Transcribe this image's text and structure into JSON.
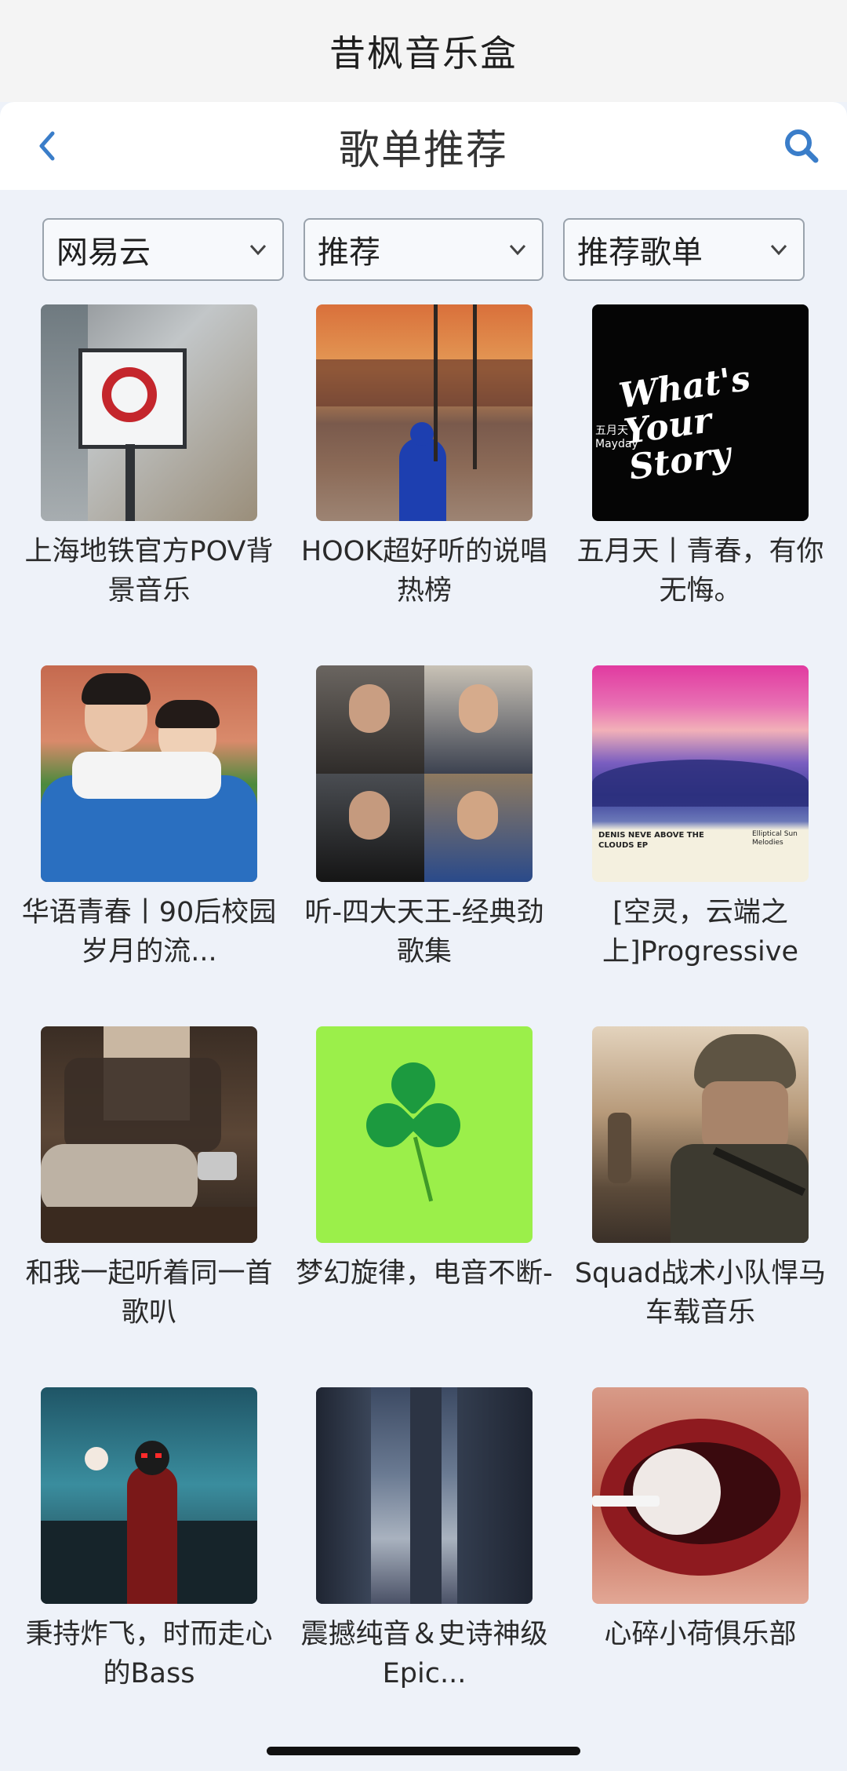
{
  "app": {
    "title": "昔枫音乐盒"
  },
  "header": {
    "title": "歌单推荐",
    "back_icon": "chevron-left-icon",
    "search_icon": "search-icon",
    "accent": "#3a7dc9"
  },
  "filters": [
    {
      "value": "网易云"
    },
    {
      "value": "推荐"
    },
    {
      "value": "推荐歌单"
    }
  ],
  "playlists": [
    {
      "name": "上海地铁官方POV背景音乐"
    },
    {
      "name": "HOOK超好听的说唱热榜"
    },
    {
      "name": "五月天丨青春，有你无悔。",
      "cover_text": "What's Your Story",
      "cover_sub": "五月天 Mayday"
    },
    {
      "name": "华语青春丨90后校园岁月的流..."
    },
    {
      "name": "听-四大天王-经典劲歌集"
    },
    {
      "name": "[空灵，云端之上]Progressive",
      "cover_text": "DENIS NEVE ABOVE THE CLOUDS EP",
      "cover_sub": "Elliptical Sun Melodies"
    },
    {
      "name": "和我一起听着同一首歌叭"
    },
    {
      "name": "梦幻旋律，电音不断-"
    },
    {
      "name": "Squad战术小队悍马车载音乐"
    },
    {
      "name": "秉持炸飞，时而走心的Bass"
    },
    {
      "name": "震撼纯音＆史诗神级Epic..."
    },
    {
      "name": "心碎小荷俱乐部"
    }
  ]
}
